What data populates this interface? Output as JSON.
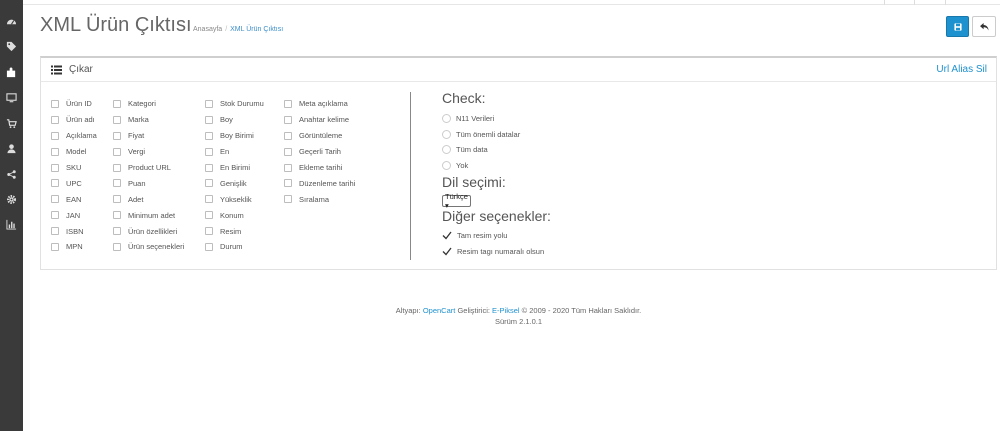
{
  "sidebar": {
    "icons": [
      "dashboard-icon",
      "tags-icon",
      "puzzle-icon",
      "desktop-icon",
      "cart-icon",
      "user-icon",
      "share-icon",
      "cog-icon",
      "bar-chart-icon"
    ]
  },
  "header": {
    "title": "XML Ürün Çıktısı",
    "breadcrumb": {
      "home": "Anasayfa",
      "separator": "/",
      "current": "XML Ürün Çıktısı"
    }
  },
  "panel": {
    "title": "Çıkar",
    "url_alias_link": "Url Alias Sil"
  },
  "fields": {
    "col1": [
      "Ürün ID",
      "Ürün adı",
      "Açıklama",
      "Model",
      "SKU",
      "UPC",
      "EAN",
      "JAN",
      "ISBN",
      "MPN"
    ],
    "col2": [
      "Kategori",
      "Marka",
      "Fiyat",
      "Vergi",
      "Product URL",
      "Puan",
      "Adet",
      "Minimum adet",
      "Ürün özellikleri",
      "Ürün seçenekleri"
    ],
    "col3": [
      "Stok Durumu",
      "Boy",
      "Boy Birimi",
      "En",
      "En Birimi",
      "Genişlik",
      "Yükseklik",
      "Konum",
      "Resim",
      "Durum"
    ],
    "col4": [
      "Meta açıklama",
      "Anahtar kelime",
      "Görüntüleme",
      "Geçerli Tarih",
      "Ekleme tarihi",
      "Düzenleme tarihi",
      "Sıralama"
    ]
  },
  "check": {
    "heading": "Check:",
    "options": [
      "N11 Verileri",
      "Tüm önemli datalar",
      "Tüm data",
      "Yok"
    ]
  },
  "language": {
    "heading": "Dil seçimi:",
    "selected": "Türkçe ▾"
  },
  "other": {
    "heading": "Diğer seçenekler:",
    "options": [
      "Tam resim yolu",
      "Resim tagı numaralı olsun"
    ]
  },
  "footer": {
    "prefix": "Altyapı:",
    "platform": "OpenCart",
    "developer_label": "Geliştirici:",
    "developer": "E-Piksel",
    "copyright": "© 2009 - 2020 Tüm Hakları Saklıdır.",
    "version": "Sürüm 2.1.0.1"
  },
  "colors": {
    "sidebar": "#3a3a3a",
    "primary": "#1e91cf",
    "text": "#555555"
  }
}
